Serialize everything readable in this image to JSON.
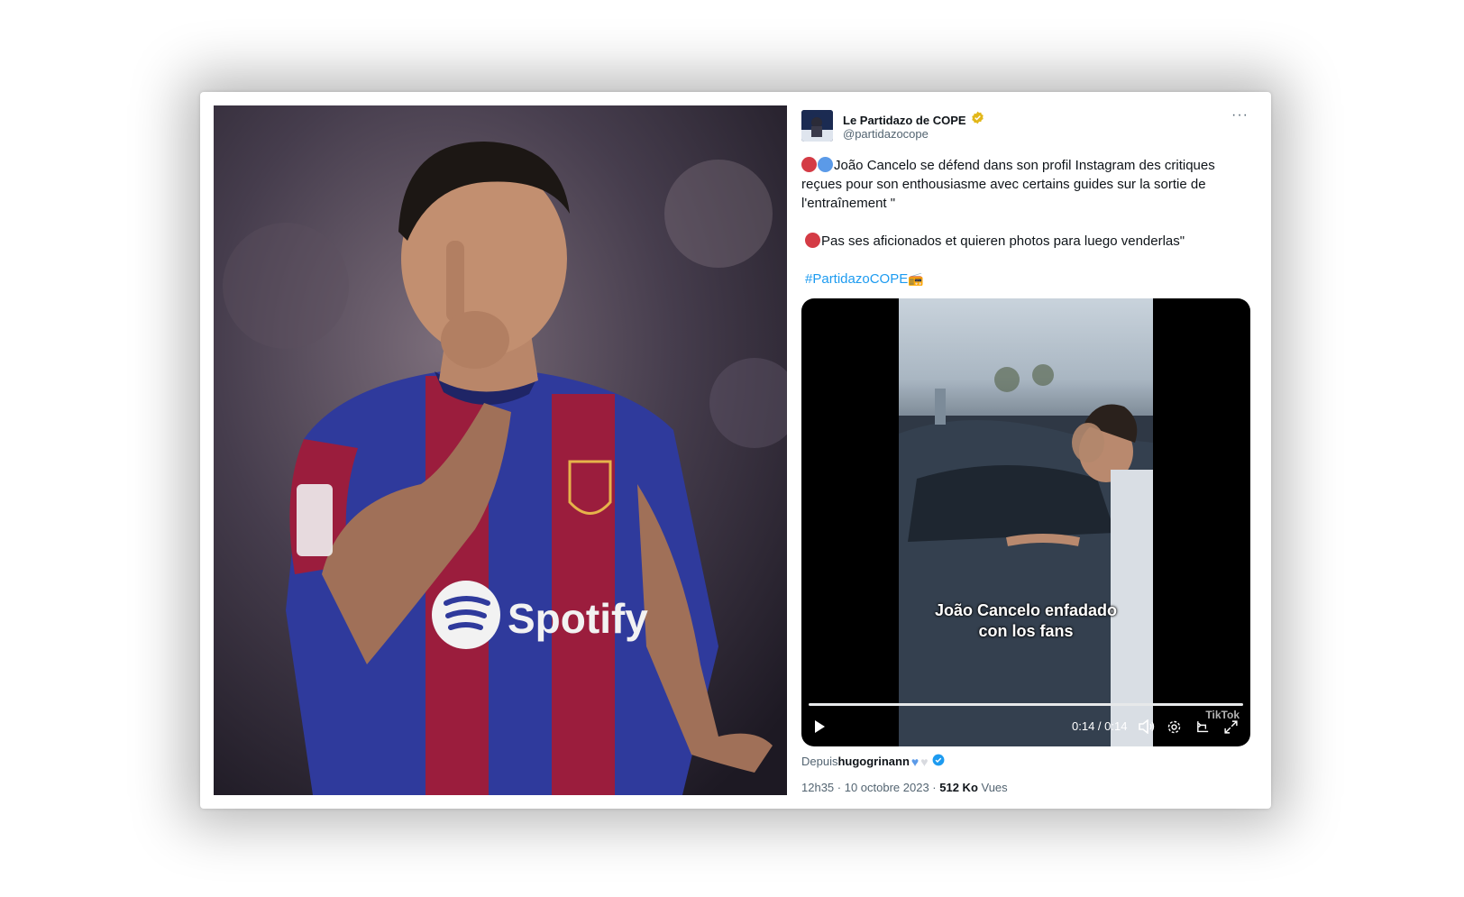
{
  "tweet": {
    "display_name": "Le Partidazo de COPE",
    "handle": "@partidazocope",
    "more_label": "···",
    "text_line1": "João Cancelo se défend dans son profil Instagram des critiques reçues pour son enthousiasme avec certains guides sur la sortie de l'entraînement \"",
    "text_line2": "Pas ses aficionados et quieren photos para luego venderlas\"",
    "hashtag": "#PartidazoCOPE",
    "source_prefix": "Depuis",
    "source_user": "hugogrinann",
    "time": "12h35",
    "sep1": " · ",
    "date": "10 octobre 2023",
    "sep2": " · ",
    "views_count": "512 Ko",
    "views_label": " Vues"
  },
  "video": {
    "subtitle_line1": "João Cancelo enfadado",
    "subtitle_line2": "con los fans",
    "watermark": "TikTok",
    "time_display": "0:14 / 0:14",
    "progress": 1.0
  },
  "photo": {
    "jersey_sponsor": "Spotify",
    "colors": {
      "blue": "#2f3a9c",
      "garnet": "#9b1d3d",
      "gold": "#e6b34a"
    }
  },
  "colors": {
    "accent": "#1d9bf0",
    "text": "#0f1419",
    "muted": "#536471",
    "verified_gold": "#e2b719"
  },
  "icons": [
    "verified-badge-icon",
    "more-icon",
    "play-icon",
    "volume-icon",
    "settings-icon",
    "rotate-icon",
    "fullscreen-icon"
  ]
}
